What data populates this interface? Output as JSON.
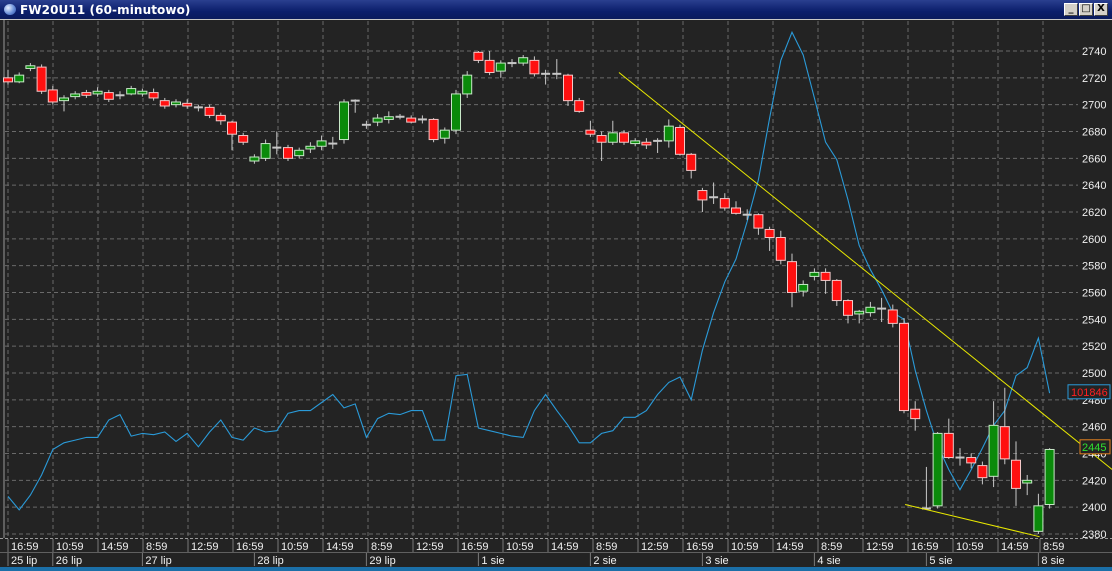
{
  "window": {
    "title": "FW20U11 (60-minutowo)",
    "minimize": "_",
    "maximize": "□",
    "close": "X"
  },
  "colors": {
    "background": "#232323",
    "up": "#0a8a0a",
    "down": "#ff1010",
    "indicator": "#2a9ad8",
    "trendline": "#e8e800",
    "grid": "#6a6a6a"
  },
  "chart_data": {
    "type": "candlestick",
    "title": "FW20U11 (60-minutowo)",
    "ylim": [
      2380,
      2760
    ],
    "y_ticks": [
      2740,
      2720,
      2700,
      2680,
      2660,
      2640,
      2620,
      2600,
      2580,
      2560,
      2540,
      2520,
      2500,
      2480,
      2460,
      2440,
      2420,
      2400,
      2380
    ],
    "time_labels": [
      "16:59",
      "10:59",
      "14:59",
      "8:59",
      "12:59",
      "16:59",
      "10:59",
      "14:59",
      "8:59",
      "12:59",
      "16:59",
      "10:59",
      "14:59",
      "8:59",
      "12:59",
      "16:59",
      "10:59",
      "14:59",
      "8:59",
      "12:59",
      "16:59",
      "10:59",
      "14:59",
      "8:59"
    ],
    "date_labels": [
      {
        "label": "25 lip",
        "candle": 0
      },
      {
        "label": "26 lip",
        "candle": 4
      },
      {
        "label": "27 lip",
        "candle": 12
      },
      {
        "label": "28 lip",
        "candle": 22
      },
      {
        "label": "29 lip",
        "candle": 32
      },
      {
        "label": "1 sie",
        "candle": 42
      },
      {
        "label": "2 sie",
        "candle": 52
      },
      {
        "label": "3 sie",
        "candle": 62
      },
      {
        "label": "4 sie",
        "candle": 72
      },
      {
        "label": "5 sie",
        "candle": 82
      },
      {
        "label": "8 sie",
        "candle": 92
      }
    ],
    "candles_ohlc": [
      [
        2720,
        2726,
        2715,
        2717
      ],
      [
        2717,
        2724,
        2716,
        2722
      ],
      [
        2727,
        2731,
        2725,
        2729
      ],
      [
        2728,
        2730,
        2708,
        2710
      ],
      [
        2711,
        2714,
        2700,
        2702
      ],
      [
        2703,
        2707,
        2695,
        2705
      ],
      [
        2706,
        2710,
        2704,
        2708
      ],
      [
        2709,
        2711,
        2705,
        2707
      ],
      [
        2708,
        2713,
        2706,
        2710
      ],
      [
        2709,
        2711,
        2702,
        2704
      ],
      [
        2706,
        2710,
        2704,
        2707
      ],
      [
        2708,
        2714,
        2707,
        2712
      ],
      [
        2708,
        2712,
        2706,
        2710
      ],
      [
        2709,
        2712,
        2703,
        2705
      ],
      [
        2703,
        2705,
        2697,
        2699
      ],
      [
        2700,
        2704,
        2698,
        2702
      ],
      [
        2701,
        2704,
        2697,
        2699
      ],
      [
        2698,
        2700,
        2695,
        2697
      ],
      [
        2698,
        2700,
        2690,
        2692
      ],
      [
        2692,
        2694,
        2685,
        2688
      ],
      [
        2687,
        2688,
        2666,
        2678
      ],
      [
        2677,
        2679,
        2670,
        2672
      ],
      [
        2658,
        2663,
        2656,
        2661
      ],
      [
        2660,
        2674,
        2658,
        2671
      ],
      [
        2668,
        2680,
        2663,
        2668
      ],
      [
        2668,
        2670,
        2658,
        2660
      ],
      [
        2662,
        2668,
        2660,
        2666
      ],
      [
        2667,
        2672,
        2664,
        2669
      ],
      [
        2669,
        2677,
        2666,
        2673
      ],
      [
        2671,
        2676,
        2667,
        2671
      ],
      [
        2674,
        2704,
        2671,
        2702
      ],
      [
        2703,
        2704,
        2694,
        2703
      ],
      [
        2685,
        2688,
        2682,
        2685
      ],
      [
        2687,
        2693,
        2684,
        2690
      ],
      [
        2689,
        2695,
        2686,
        2691
      ],
      [
        2691,
        2693,
        2689,
        2691
      ],
      [
        2690,
        2692,
        2686,
        2687
      ],
      [
        2688,
        2692,
        2686,
        2689
      ],
      [
        2689,
        2690,
        2672,
        2674
      ],
      [
        2675,
        2683,
        2671,
        2681
      ],
      [
        2681,
        2711,
        2678,
        2708
      ],
      [
        2708,
        2725,
        2705,
        2722
      ],
      [
        2739,
        2740,
        2731,
        2733
      ],
      [
        2733,
        2740,
        2722,
        2724
      ],
      [
        2725,
        2733,
        2720,
        2731
      ],
      [
        2731,
        2734,
        2728,
        2731
      ],
      [
        2731,
        2737,
        2729,
        2735
      ],
      [
        2733,
        2736,
        2721,
        2723
      ],
      [
        2723,
        2726,
        2715,
        2723
      ],
      [
        2723,
        2734,
        2719,
        2723
      ],
      [
        2722,
        2723,
        2699,
        2703
      ],
      [
        2703,
        2705,
        2694,
        2695
      ],
      [
        2681,
        2688,
        2676,
        2678
      ],
      [
        2677,
        2680,
        2658,
        2672
      ],
      [
        2672,
        2688,
        2670,
        2679
      ],
      [
        2679,
        2681,
        2670,
        2672
      ],
      [
        2671,
        2675,
        2669,
        2673
      ],
      [
        2672,
        2675,
        2667,
        2670
      ],
      [
        2673,
        2675,
        2664,
        2673
      ],
      [
        2673,
        2689,
        2668,
        2684
      ],
      [
        2683,
        2685,
        2662,
        2663
      ],
      [
        2663,
        2664,
        2645,
        2651
      ],
      [
        2636,
        2638,
        2620,
        2629
      ],
      [
        2631,
        2642,
        2626,
        2631
      ],
      [
        2630,
        2634,
        2621,
        2623
      ],
      [
        2623,
        2628,
        2618,
        2619
      ],
      [
        2618,
        2622,
        2614,
        2618
      ],
      [
        2618,
        2619,
        2603,
        2608
      ],
      [
        2607,
        2609,
        2591,
        2601
      ],
      [
        2601,
        2606,
        2581,
        2584
      ],
      [
        2583,
        2589,
        2549,
        2560
      ],
      [
        2561,
        2569,
        2557,
        2566
      ],
      [
        2572,
        2578,
        2569,
        2575
      ],
      [
        2575,
        2578,
        2559,
        2569
      ],
      [
        2569,
        2570,
        2550,
        2554
      ],
      [
        2554,
        2555,
        2537,
        2543
      ],
      [
        2544,
        2547,
        2537,
        2546
      ],
      [
        2545,
        2553,
        2542,
        2549
      ],
      [
        2548,
        2556,
        2538,
        2547
      ],
      [
        2547,
        2551,
        2534,
        2537
      ],
      [
        2537,
        2541,
        2470,
        2472
      ],
      [
        2473,
        2479,
        2457,
        2466
      ],
      [
        2399,
        2430,
        2398,
        2399
      ],
      [
        2401,
        2456,
        2399,
        2455
      ],
      [
        2455,
        2466,
        2436,
        2437
      ],
      [
        2437,
        2444,
        2431,
        2437
      ],
      [
        2437,
        2440,
        2429,
        2433
      ],
      [
        2431,
        2434,
        2417,
        2422
      ],
      [
        2423,
        2479,
        2415,
        2461
      ],
      [
        2460,
        2489,
        2432,
        2436
      ],
      [
        2435,
        2449,
        2401,
        2414
      ],
      [
        2418,
        2424,
        2409,
        2420
      ],
      [
        2382,
        2410,
        2380,
        2401
      ],
      [
        2402,
        2444,
        2399,
        2443
      ]
    ],
    "indicator_line_on_price_scale": [
      2408,
      2398,
      2409,
      2424,
      2443,
      2448,
      2450,
      2452,
      2452,
      2465,
      2469,
      2453,
      2455,
      2454,
      2456,
      2449,
      2455,
      2445,
      2456,
      2465,
      2452,
      2450,
      2459,
      2456,
      2457,
      2470,
      2472,
      2472,
      2478,
      2484,
      2474,
      2477,
      2452,
      2466,
      2470,
      2469,
      2472,
      2472,
      2450,
      2450,
      2498,
      2499,
      2459,
      2457,
      2455,
      2453,
      2452,
      2472,
      2484,
      2472,
      2461,
      2448,
      2448,
      2455,
      2457,
      2467,
      2467,
      2472,
      2484,
      2493,
      2497,
      2480,
      2517,
      2545,
      2568,
      2585,
      2613,
      2644,
      2690,
      2733,
      2754,
      2737,
      2705,
      2672,
      2659,
      2629,
      2595,
      2577,
      2562,
      2545,
      2540,
      2502,
      2472,
      2446,
      2428,
      2413,
      2428,
      2444,
      2461,
      2472,
      2498,
      2504,
      2526,
      2485
    ],
    "trendlines": [
      {
        "from": {
          "candle": 54.55,
          "price": 2724
        },
        "to": {
          "candle": 98.6,
          "price": 2428
        }
      },
      {
        "from": {
          "candle": 80.1,
          "price": 2402
        },
        "to": {
          "candle": 92.1,
          "price": 2378
        }
      }
    ],
    "indicator_value_label": "101846",
    "last_price_label": "2445"
  }
}
